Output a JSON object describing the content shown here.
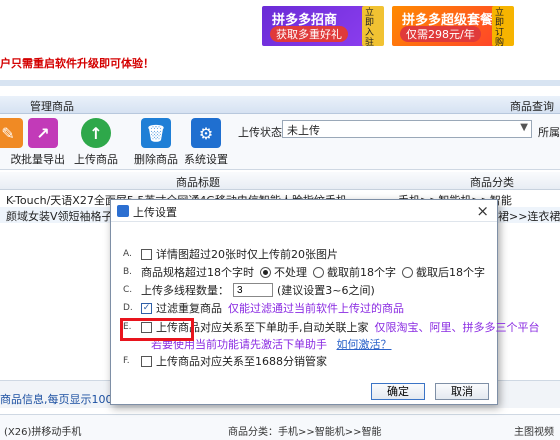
{
  "ads": {
    "left": {
      "title": "拼多多招商",
      "subtitle": "获取多重好礼",
      "side": "立即入驻"
    },
    "right": {
      "title": "拼多多超级套餐",
      "subtitle": "仅需298元/年",
      "side": "立即订购"
    }
  },
  "notice": "户只需重启软件升级即可体验！",
  "menu": {
    "manage": "管理商品",
    "query": "商品查询"
  },
  "toolbar": {
    "edit": "改",
    "batch_export": "批量导出",
    "upload_goods": "上传商品",
    "delete_goods": "删除商品",
    "system_settings": "系统设置",
    "upload_status_label": "上传状态",
    "upload_status_value": "未上传",
    "attr_label": "所属"
  },
  "table": {
    "headers": [
      "商品标题",
      "商品分类"
    ],
    "rows": [
      {
        "title": "K-Touch/天语X27全面屏5.5英寸全网通4G移动电信智能人脸指纹手机",
        "category": "手机>>智能机>>智能"
      },
      {
        "title": "颜域女装V领短袖格子连衣",
        "category": "裙>>连衣裙"
      }
    ]
  },
  "footer": {
    "info": "商品信息,每页显示100条,当",
    "bottom_left": "(X26)拼移动手机",
    "bottom_mid": "商品分类：手机>>智能机>>智能",
    "bottom_right": "主图视频"
  },
  "dialog": {
    "title": "上传设置",
    "option_a": {
      "letter": "A.",
      "label": "详情图超过20张时仅上传前20张图片",
      "checked": false
    },
    "option_b": {
      "letter": "B.",
      "label": "商品规格超过18个字时",
      "choices": [
        "不处理",
        "截取前18个字",
        "截取后18个字"
      ],
      "selected": 0
    },
    "option_c": {
      "letter": "C.",
      "label": "上传多线程数量：",
      "value": "3",
      "hint": "(建议设置3~6之间)"
    },
    "option_d": {
      "letter": "D.",
      "label": "过滤重复商品",
      "checked": true,
      "note": "仅能过滤通过当前软件上传过的商品"
    },
    "option_e": {
      "letter": "E.",
      "label": "上传商品对应关系至下单助手,自动关联上家",
      "checked": false,
      "note": "仅限淘宝、阿里、拼多多三个平台",
      "sub_note": "若要使用当前功能请先激活下单助手",
      "link": "如何激活？"
    },
    "option_f": {
      "letter": "F.",
      "label": "上传商品对应关系至1688分销管家",
      "checked": false
    },
    "ok": "确定",
    "cancel": "取消"
  }
}
